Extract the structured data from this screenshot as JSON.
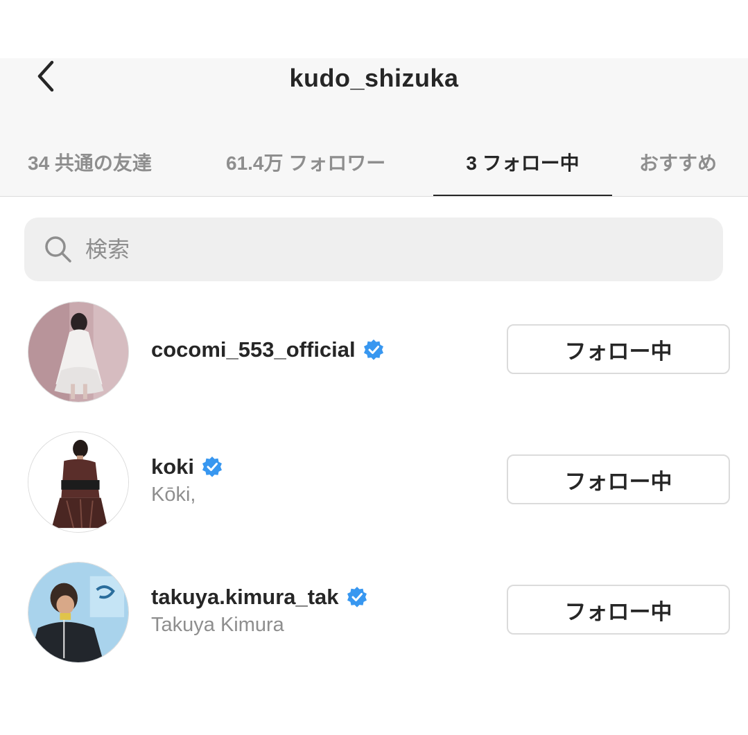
{
  "header": {
    "title": "kudo_shizuka"
  },
  "tabs": [
    {
      "label": "34 共通の友達",
      "active": false
    },
    {
      "label": "61.4万 フォロワー",
      "active": false
    },
    {
      "label": "3 フォロー中",
      "active": true
    },
    {
      "label": "おすすめ",
      "active": false
    }
  ],
  "search": {
    "placeholder": "検索"
  },
  "accounts": [
    {
      "username": "cocomi_553_official",
      "full_name": "",
      "verified": true,
      "button_label": "フォロー中"
    },
    {
      "username": "koki",
      "full_name": "Kōki,",
      "verified": true,
      "button_label": "フォロー中"
    },
    {
      "username": "takuya.kimura_tak",
      "full_name": "Takuya Kimura",
      "verified": true,
      "button_label": "フォロー中"
    }
  ],
  "colors": {
    "verified_badge": "#3897f0",
    "text_primary": "#262626",
    "text_secondary": "#8e8e8e",
    "header_bg": "#f7f7f7",
    "search_bg": "#efefef"
  }
}
